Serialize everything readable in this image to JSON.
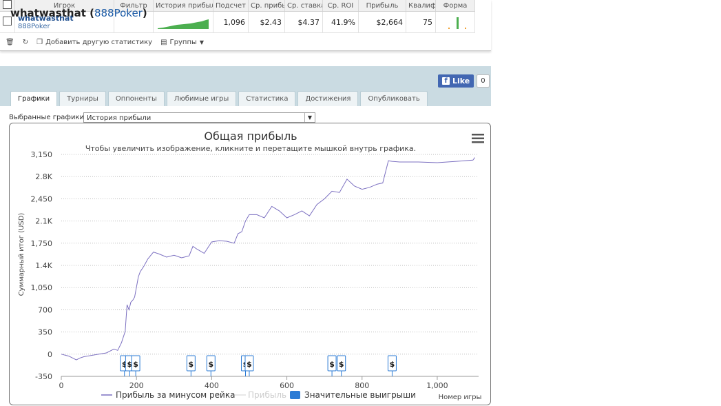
{
  "table": {
    "headers": [
      "Игрок",
      "Фильтр",
      "История прибыли",
      "Подсчет",
      "Ср. прибыль",
      "Ср. ставка",
      "Ср. ROI",
      "Прибыль",
      "Квалиф.",
      "Форма"
    ],
    "row": {
      "player": "whatwasthat",
      "site": "888Poker",
      "count": "1,096",
      "avg_profit": "$2.43",
      "avg_stake": "$4.37",
      "avg_roi": "41.9%",
      "profit": "$2,664",
      "qualif": "75"
    }
  },
  "toolbar": {
    "add_stats": "Добавить другую статистику",
    "groups": "Группы"
  },
  "player_panel": {
    "name": "whatwasthat",
    "site": "888Poker",
    "like_label": "Like",
    "like_count": "0",
    "tabs": [
      "Графики",
      "Турниры",
      "Оппоненты",
      "Любимые игры",
      "Статистика",
      "Достижения",
      "Опубликовать"
    ],
    "active_tab": "Графики"
  },
  "chart_selector": {
    "label": "Выбранные графики:",
    "value": "История прибыли"
  },
  "chart_data": {
    "type": "line",
    "title": "Общая прибыль",
    "subtitle": "Чтобы увеличить изображение, кликните и перетащите мышкой внутрь графика.",
    "ylabel": "Суммарный итог (USD)",
    "xlabel": "Номер игры",
    "y_ticks": [
      "3,150",
      "2.8K",
      "2,450",
      "2.1K",
      "1,750",
      "1.4K",
      "1,050",
      "700",
      "350",
      "0",
      "-350"
    ],
    "y_tick_values": [
      3150,
      2800,
      2450,
      2100,
      1750,
      1400,
      1050,
      700,
      350,
      0,
      -350
    ],
    "x_ticks": [
      "0",
      "200",
      "400",
      "600",
      "800",
      "1,000"
    ],
    "x_tick_values": [
      0,
      200,
      400,
      600,
      800,
      1000
    ],
    "xlim": [
      0,
      1110
    ],
    "ylim": [
      -350,
      3150
    ],
    "grid": true,
    "series": [
      {
        "name": "Прибыль за минусом рейка",
        "color": "#7b6fc0",
        "x": [
          0,
          20,
          40,
          50,
          60,
          80,
          100,
          120,
          140,
          150,
          160,
          170,
          175,
          180,
          185,
          190,
          195,
          205,
          210,
          220,
          230,
          245,
          260,
          280,
          300,
          320,
          340,
          350,
          360,
          380,
          400,
          420,
          440,
          460,
          470,
          480,
          490,
          500,
          520,
          540,
          560,
          580,
          600,
          620,
          640,
          660,
          680,
          700,
          720,
          740,
          760,
          780,
          800,
          820,
          840,
          855,
          870,
          880,
          900,
          950,
          1000,
          1050,
          1095,
          1100
        ],
        "y": [
          0,
          -30,
          -90,
          -60,
          -40,
          -20,
          0,
          20,
          80,
          60,
          180,
          360,
          780,
          700,
          820,
          850,
          900,
          1220,
          1300,
          1390,
          1500,
          1610,
          1580,
          1530,
          1560,
          1520,
          1550,
          1700,
          1660,
          1590,
          1770,
          1790,
          1780,
          1750,
          1900,
          1930,
          2100,
          2200,
          2200,
          2150,
          2330,
          2260,
          2150,
          2200,
          2260,
          2180,
          2360,
          2450,
          2570,
          2550,
          2760,
          2650,
          2600,
          2630,
          2680,
          2700,
          3050,
          3040,
          3030,
          3030,
          3020,
          3040,
          3060,
          3100
        ]
      },
      {
        "name": "Прибыль",
        "color": "#e0e0e0",
        "x": [],
        "y": []
      }
    ],
    "big_wins_label": "Значительные выигрыши",
    "big_wins_x": [
      168,
      182,
      198,
      345,
      398,
      490,
      500,
      720,
      745,
      880
    ]
  }
}
